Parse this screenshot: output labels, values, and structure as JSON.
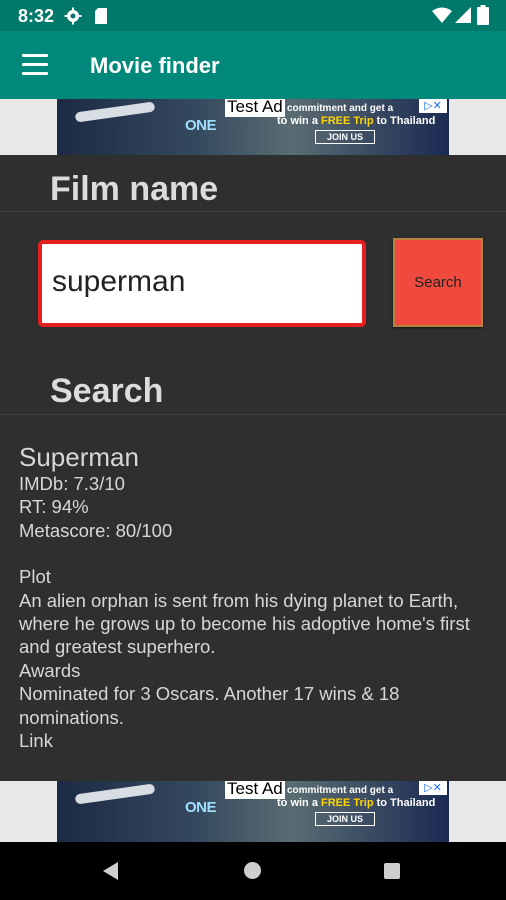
{
  "status": {
    "time": "8:32",
    "icons": [
      "gear-icon",
      "sd-card-icon",
      "wifi-icon",
      "signal-icon",
      "battery-icon"
    ]
  },
  "appbar": {
    "title": "Movie finder",
    "menu_icon": "hamburger-menu-icon"
  },
  "ad": {
    "label": "Test Ad",
    "text1": "commitment  and get a",
    "text2_prefix": "to win a ",
    "text2_highlight": "FREE Trip",
    "text2_suffix": " to Thailand",
    "join": "JOIN US",
    "brand": "ONE"
  },
  "form": {
    "film_name_label": "Film name",
    "input_value": "superman",
    "search_button": "Search",
    "search_heading": "Search"
  },
  "result": {
    "title": "Superman",
    "imdb": "IMDb: 7.3/10",
    "rt": "RT: 94%",
    "metascore": "Metascore: 80/100",
    "plot_label": "Plot",
    "plot": "An alien orphan is sent from his dying planet to Earth, where he grows up to become his adoptive home's first and greatest superhero.",
    "awards_label": "Awards",
    "awards": "Nominated for 3 Oscars. Another 17 wins & 18 nominations.",
    "link_label": "Link"
  },
  "colors": {
    "appbar": "#00897b",
    "statusbar": "#00796b",
    "accent_red": "#e41f1f",
    "button": "#f04a3e",
    "background": "#2f2f2f"
  }
}
